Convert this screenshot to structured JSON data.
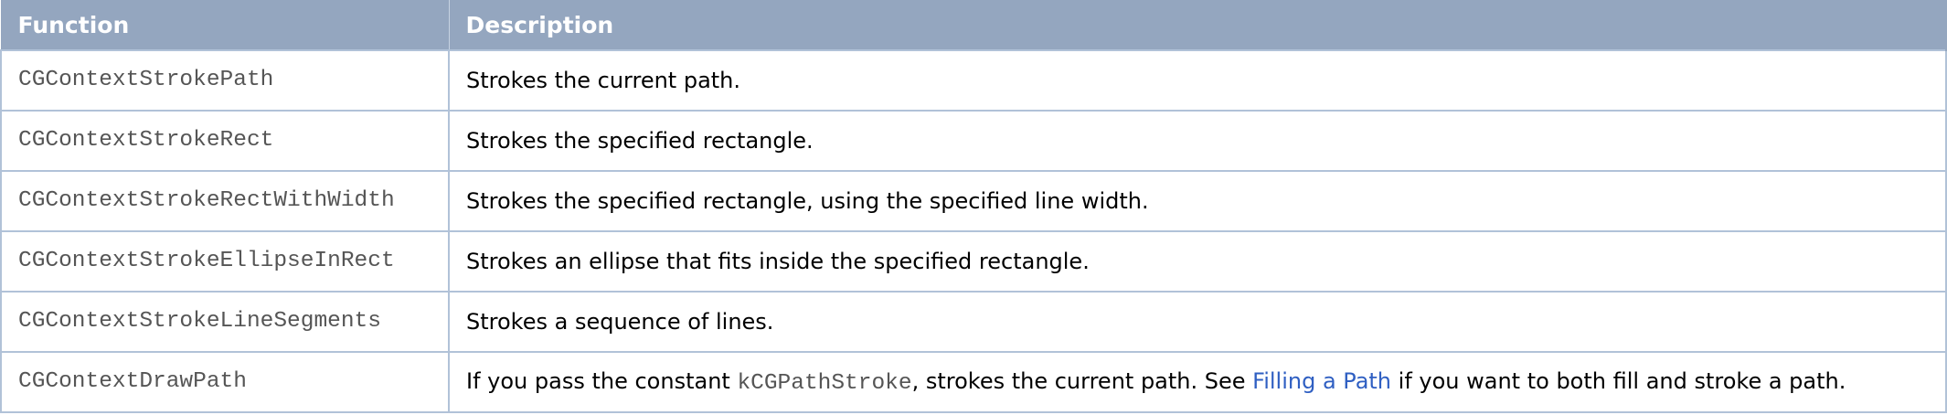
{
  "table": {
    "headers": {
      "function": "Function",
      "description": "Description"
    },
    "rows": [
      {
        "function": "CGContextStrokePath",
        "description": "Strokes the current path."
      },
      {
        "function": "CGContextStrokeRect",
        "description": "Strokes the specified rectangle."
      },
      {
        "function": "CGContextStrokeRectWithWidth",
        "description": "Strokes the specified rectangle, using the specified line width."
      },
      {
        "function": "CGContextStrokeEllipseInRect",
        "description": "Strokes an ellipse that fits inside the specified rectangle."
      },
      {
        "function": "CGContextStrokeLineSegments",
        "description": "Strokes a sequence of lines."
      },
      {
        "function": "CGContextDrawPath",
        "description_prefix": "If you pass the constant ",
        "description_code": "kCGPathStroke",
        "description_mid": ", strokes the current path. See ",
        "description_link": "Filling a Path",
        "description_suffix": " if you want to both fill and stroke a path."
      }
    ]
  },
  "colors": {
    "header_bg": "#94a6bf",
    "header_text": "#ffffff",
    "border": "#b1c2d8",
    "code_text": "#555555",
    "link": "#2f5fc2"
  }
}
